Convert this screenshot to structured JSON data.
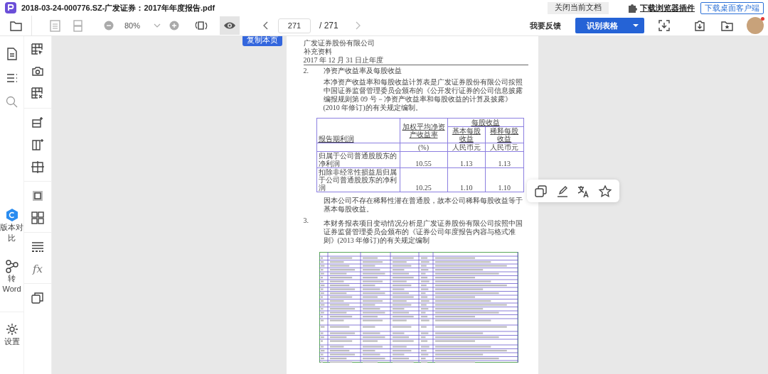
{
  "title_bar": {
    "title": "2018-03-24-000776.SZ-广发证券：2017年年度报告.pdf",
    "close_button": "关闭当前文档",
    "plugin_link": "下载浏览器插件",
    "client_button": "下载桌面客户端"
  },
  "toolbar": {
    "zoom": "80%",
    "page_input": "271",
    "page_total": "/ 271",
    "preview_selected": true,
    "feedback": "我要反馈",
    "recognize_button": "识别表格",
    "notification_dot": true
  },
  "sidebar": {
    "items": [
      {
        "kind": "document"
      },
      {
        "kind": "outline"
      },
      {
        "kind": "search"
      },
      {
        "kind": "compare",
        "label": "版本对比"
      },
      {
        "kind": "word",
        "label": "转Word"
      },
      {
        "kind": "settings",
        "label": "设置"
      }
    ]
  },
  "table_tools": {
    "items": [
      {
        "kind": "select-table"
      },
      {
        "kind": "camera"
      },
      {
        "kind": "delete-table"
      },
      {
        "kind": "insert-row",
        "group_start": true
      },
      {
        "kind": "insert-column"
      },
      {
        "kind": "split"
      },
      {
        "kind": "frame",
        "group_start": true
      },
      {
        "kind": "merge"
      },
      {
        "kind": "ocr-lines",
        "group_start": true
      },
      {
        "kind": "formula",
        "label": "fx"
      },
      {
        "kind": "copy-add",
        "group_start": true
      }
    ]
  },
  "copy_page_button": "复制本页",
  "document": {
    "header_lines": [
      "广发证券股份有限公司",
      "补充资料",
      "2017 年 12 月 31 日止年度"
    ],
    "sections": [
      {
        "number": "2.",
        "heading": "净资产收益率及每股收益",
        "paragraph": "本净资产收益率和每股收益计算表是广发证券股份有限公司按照中国证券监督管理委员会颁布的《公开发行证券的公司信息披露编报规则第 09 号－净资产收益率和每股收益的计算及披露》(2010 年修订)的有关规定编制。",
        "table": {
          "row_header": "报告期利润",
          "col_1": "加权平均净资产收益率",
          "group": "每股收益",
          "col_2": "基本每股收益",
          "col_3": "稀释每股收益",
          "unit_1": "(%)",
          "unit_2": "人民币元",
          "unit_3": "人民币元",
          "rows": [
            {
              "label": "归属于公司普通股股东的净利润",
              "values": [
                "10.55",
                "1.13",
                "1.13"
              ]
            },
            {
              "label": "扣除非经常性损益后归属于公司普通股股东的净利润",
              "values": [
                "10.25",
                "1.10",
                "1.10"
              ]
            }
          ]
        },
        "note": "因本公司不存在稀释性潜在普通股，故本公司稀释每股收益等于基本每股收益。"
      },
      {
        "number": "3.",
        "paragraph": "本财务报表项目变动情况分析是广发证券股份有限公司按照中国证券监督管理委员会颁布的《证券公司年度报告内容与格式准则》(2013 年修订)的有关规定编制"
      }
    ]
  },
  "float_tools": [
    {
      "kind": "copy"
    },
    {
      "kind": "edit"
    },
    {
      "kind": "translate"
    },
    {
      "kind": "favorite"
    }
  ]
}
